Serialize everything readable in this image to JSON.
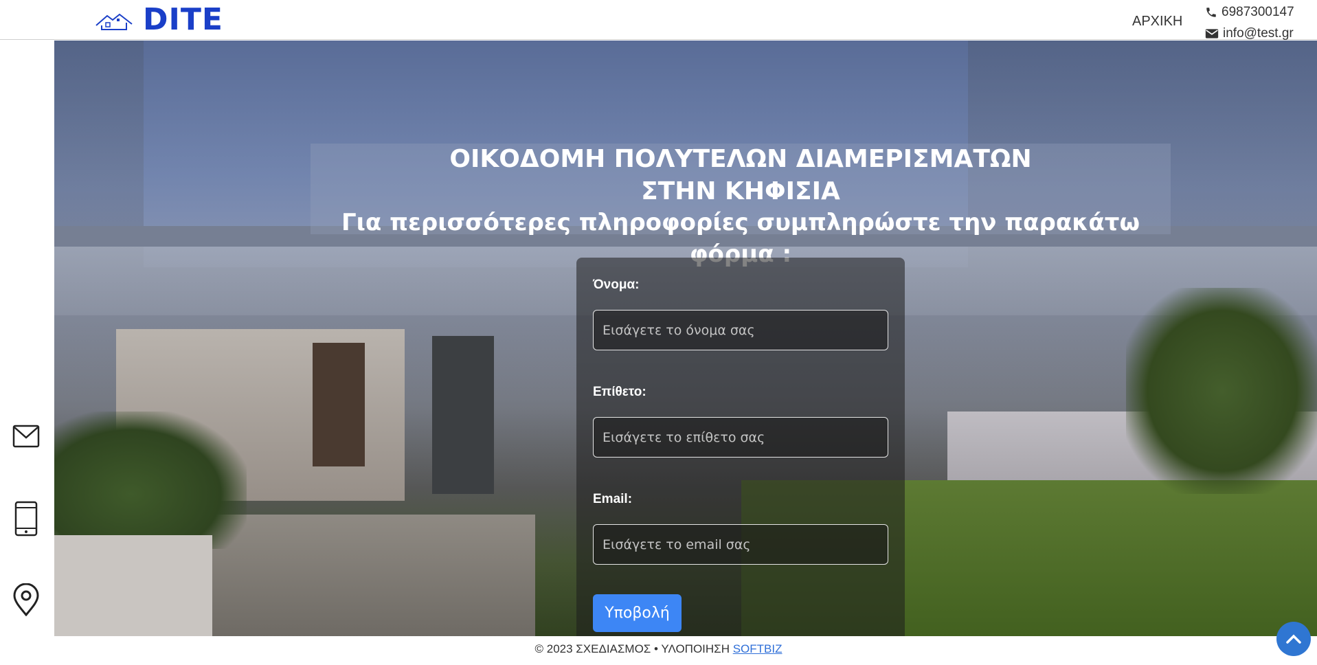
{
  "header": {
    "logo_text": "DITE",
    "nav_home": "ΑΡΧΙΚΗ",
    "phone": "6987300147",
    "email": "info@test.gr"
  },
  "rail": {
    "icons": [
      "mail-icon",
      "mobile-icon",
      "location-pin-icon"
    ]
  },
  "hero": {
    "title_line1": "ΟΙΚΟΔΟΜΗ ΠΟΛΥΤΕΛΩΝ ΔΙΑΜΕΡΙΣΜΑΤΩΝ",
    "title_line2": "ΣΤΗΝ ΚΗΦΙΣΙΑ",
    "subtitle": "Για περισσότερες πληροφορίες συμπληρώστε την παρακάτω φόρμα :"
  },
  "form": {
    "name_label": "Όνομα:",
    "name_placeholder": "Εισάγετε το όνομα σας",
    "surname_label": "Επίθετο:",
    "surname_placeholder": "Εισάγετε το επίθετο σας",
    "email_label": "Email:",
    "email_placeholder": "Εισάγετε το email σας",
    "submit_label": "Υποβολή"
  },
  "footer": {
    "text": "© 2023 ΣΧΕΔΙΑΣΜΟΣ • ΥΛΟΠΟΙΗΣΗ",
    "link": "SOFTBIZ"
  },
  "colors": {
    "brand": "#1a3fc8",
    "button": "#3d86f5",
    "back_to_top": "#2f76d2"
  }
}
